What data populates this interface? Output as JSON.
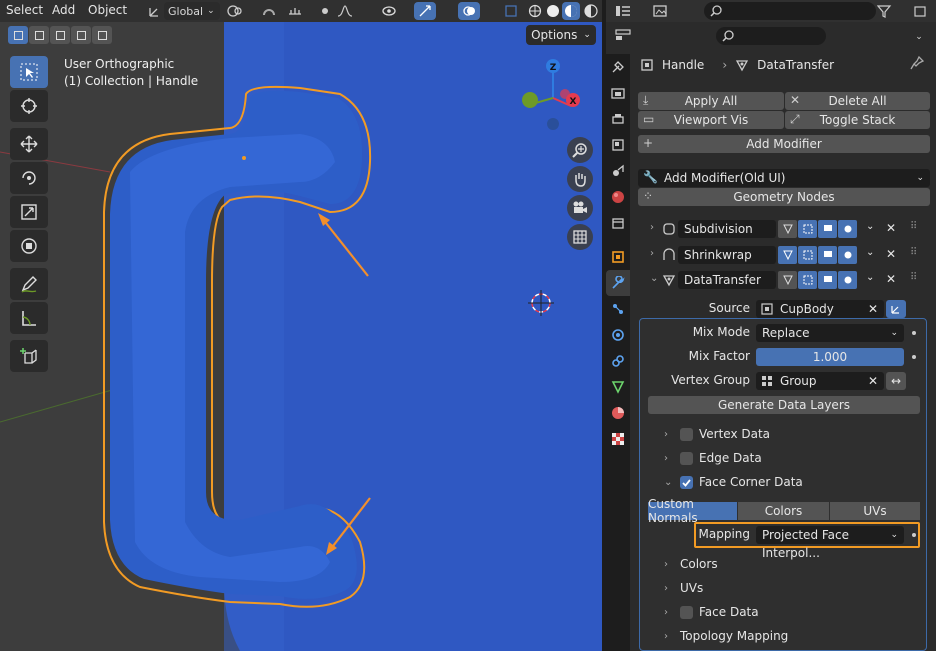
{
  "viewport": {
    "header": {
      "menu": [
        "Select",
        "Add",
        "Object"
      ],
      "transform_orientation": "Global",
      "options_label": "Options"
    },
    "view_info": {
      "projection": "User Orthographic",
      "collection_object": "(1) Collection | Handle"
    },
    "gizmo_axes": {
      "z": "Z",
      "x": "X",
      "y": "Y"
    },
    "accent_colors": {
      "mesh_blue": "#2a57c4",
      "selection_outline": "#f29b24",
      "axis_x": "#e43b4f",
      "axis_y": "#6d9a27",
      "axis_z": "#2f7ce0"
    }
  },
  "properties": {
    "breadcrumb": {
      "object": "Handle",
      "modifier": "DataTransfer"
    },
    "buttons": {
      "apply_all": "Apply All",
      "delete_all": "Delete All",
      "viewport_vis": "Viewport Vis",
      "toggle_stack": "Toggle Stack",
      "add_modifier": "Add Modifier",
      "add_modifier_old": "Add Modifier(Old UI)",
      "geometry_nodes": "Geometry Nodes"
    },
    "modifiers": [
      {
        "name": "Subdivision",
        "expanded": false
      },
      {
        "name": "Shrinkwrap",
        "expanded": false
      },
      {
        "name": "DataTransfer",
        "expanded": true
      }
    ],
    "datatransfer": {
      "source_label": "Source",
      "source_value": "CupBody",
      "mix_mode_label": "Mix Mode",
      "mix_mode_value": "Replace",
      "mix_factor_label": "Mix Factor",
      "mix_factor_value": "1.000",
      "vertex_group_label": "Vertex Group",
      "vertex_group_value": "Group",
      "generate_label": "Generate Data Layers",
      "vertex_data": "Vertex Data",
      "edge_data": "Edge Data",
      "face_corner_data": "Face Corner Data",
      "face_corner_checked": true,
      "tabs": [
        "Custom Normals",
        "Colors",
        "UVs"
      ],
      "active_tab": "Custom Normals",
      "mapping_label": "Mapping",
      "mapping_value": "Projected Face Interpol...",
      "colors": "Colors",
      "uvs": "UVs",
      "face_data": "Face Data",
      "topology_mapping": "Topology Mapping"
    }
  }
}
